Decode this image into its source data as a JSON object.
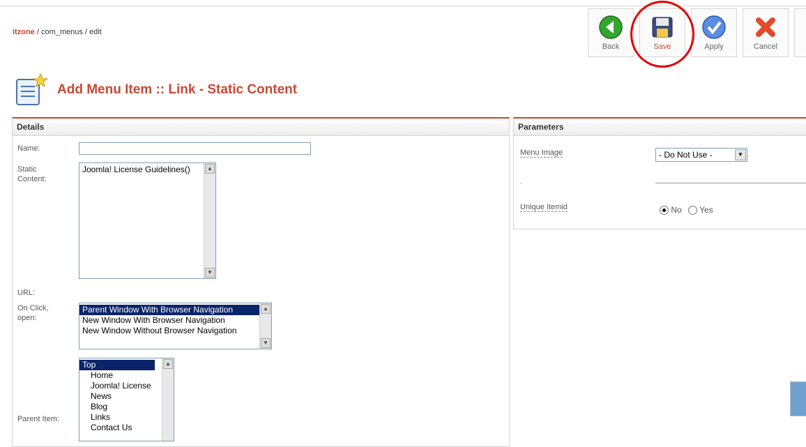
{
  "breadcrumb": {
    "site": "itzone",
    "rest": " / com_menus / edit"
  },
  "toolbar": {
    "back": "Back",
    "save": "Save",
    "apply": "Apply",
    "cancel": "Cancel"
  },
  "page": {
    "title": "Add Menu Item :: Link - Static Content"
  },
  "details": {
    "heading": "Details",
    "name_label": "Name:",
    "name_value": "",
    "static_label_1": "Static",
    "static_label_2": "Content:",
    "static_options": [
      "Joomla! License Guidelines()"
    ],
    "url_label": "URL:",
    "onclick_label_1": "On Click,",
    "onclick_label_2": "open:",
    "onclick_options": [
      "Parent Window With Browser Navigation",
      "New Window With Browser Navigation",
      "New Window Without Browser Navigation"
    ],
    "parent_label": "Parent Item:",
    "parent_options": [
      "Top",
      "Home",
      "Joomla! License",
      "News",
      "Blog",
      "Links",
      "Contact Us"
    ]
  },
  "parameters": {
    "heading": "Parameters",
    "menu_image_label": "Menu Image",
    "menu_image_value": "- Do Not Use -",
    "unique_itemid_label": "Unique Itemid",
    "no_label": "No",
    "yes_label": "Yes",
    "dash": "-"
  },
  "icons": {
    "page": "add-menu-icon",
    "back": "back-arrow-icon",
    "save": "floppy-disk-icon",
    "apply": "checkmark-icon",
    "cancel": "cancel-x-icon"
  },
  "colors": {
    "accent": "#c64934",
    "highlight": "#e30000",
    "selection": "#0a246a"
  }
}
